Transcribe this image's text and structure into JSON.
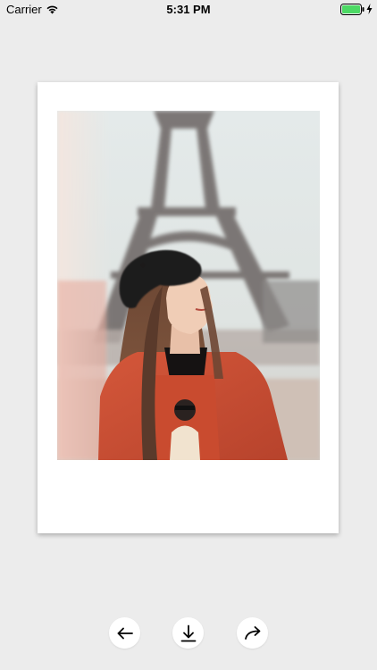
{
  "status_bar": {
    "carrier": "Carrier",
    "time": "5:31 PM",
    "wifi_icon": "wifi-icon",
    "battery_icon": "battery-icon",
    "charging_icon": "bolt-icon",
    "battery_color": "#4cd964"
  },
  "photo": {
    "subject": "photo"
  },
  "toolbar": {
    "back_icon": "arrow-left-icon",
    "download_icon": "download-icon",
    "share_icon": "share-arrow-icon"
  },
  "colors": {
    "background": "#ececec",
    "frame": "#ffffff",
    "button": "#ffffff",
    "icon_stroke": "#000000"
  }
}
